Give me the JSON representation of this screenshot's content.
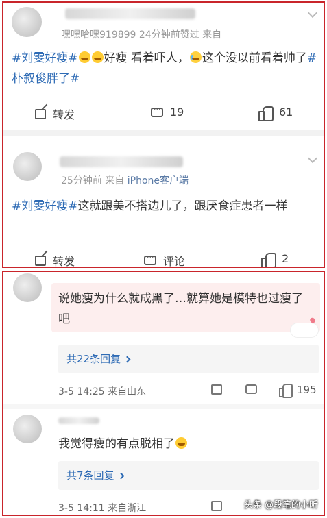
{
  "post1": {
    "user_meta": "嘿嘿哈嘿919899 24分钟前赞过 来自",
    "text_tag1": "#刘雯好瘦#",
    "text_mid": "好瘦 看着吓人，",
    "text_rest": "这个没以前看着帅了",
    "text_tag2": "#朴叙俊胖了#",
    "repost_label": "转发",
    "comment_count": "19",
    "like_count": "61"
  },
  "post2": {
    "time": "25分钟前",
    "from_label": "来自",
    "source": "iPhone客户端",
    "text_tag": "#刘雯好瘦#",
    "text_rest": "这就跟美不搭边儿了，跟厌食症患者一样",
    "repost_label": "转发",
    "comment_label": "评论",
    "like_count": "2"
  },
  "comment1": {
    "text": "说她瘦为什么就成黑了…就算她是模特也过瘦了吧",
    "replies_label": "共22条回复",
    "meta": "3-5 14:25 来自山东",
    "like_count": "195"
  },
  "comment2": {
    "text": "我觉得瘦的有点脱相了",
    "replies_label": "共7条回复",
    "meta": "3-5 14:11 来自浙江"
  },
  "watermark": "头条 @段笔的小昕",
  "colors": {
    "accent_red": "#c9252b",
    "link_blue": "#2e6bb5",
    "meta_gray": "#999999"
  },
  "icons": [
    "chevron-down-icon",
    "repost-icon",
    "comment-icon",
    "like-icon",
    "laugh-cry-emoji",
    "crying-emoji",
    "edit-icon"
  ]
}
